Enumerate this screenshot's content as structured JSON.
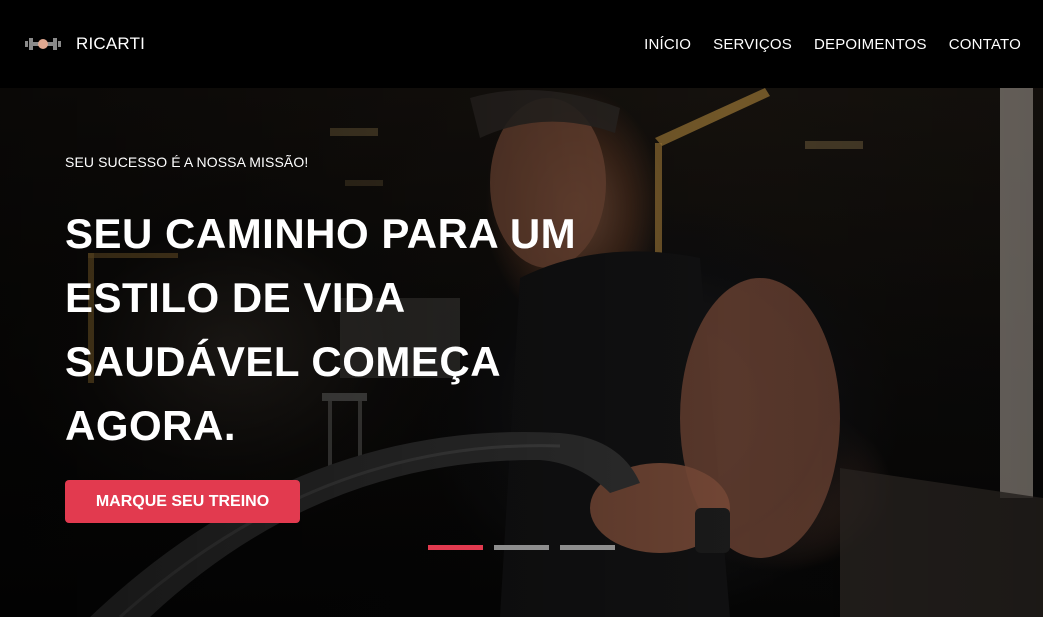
{
  "brand": {
    "name": "RICARTI",
    "icon": "dumbbell-icon",
    "icon_color": "#8a8a8a",
    "icon_accent": "#e0a890"
  },
  "nav": {
    "items": [
      {
        "label": "INÍCIO"
      },
      {
        "label": "SERVIÇOS"
      },
      {
        "label": "DEPOIMENTOS"
      },
      {
        "label": "CONTATO"
      }
    ]
  },
  "hero": {
    "subtitle": "SEU SUCESSO É A NOSSA MISSÃO!",
    "title": "SEU CAMINHO PARA UM ESTILO DE VIDA SAUDÁVEL COMEÇA AGORA.",
    "cta_label": "MARQUE SEU TREINO",
    "background_image": "athlete-battle-rope-photo",
    "slides_total": 3,
    "active_slide": 1
  },
  "colors": {
    "accent": "#e23a4f",
    "navbar_bg": "#000000",
    "indicator_inactive": "#8e8e8e",
    "text": "#ffffff"
  }
}
